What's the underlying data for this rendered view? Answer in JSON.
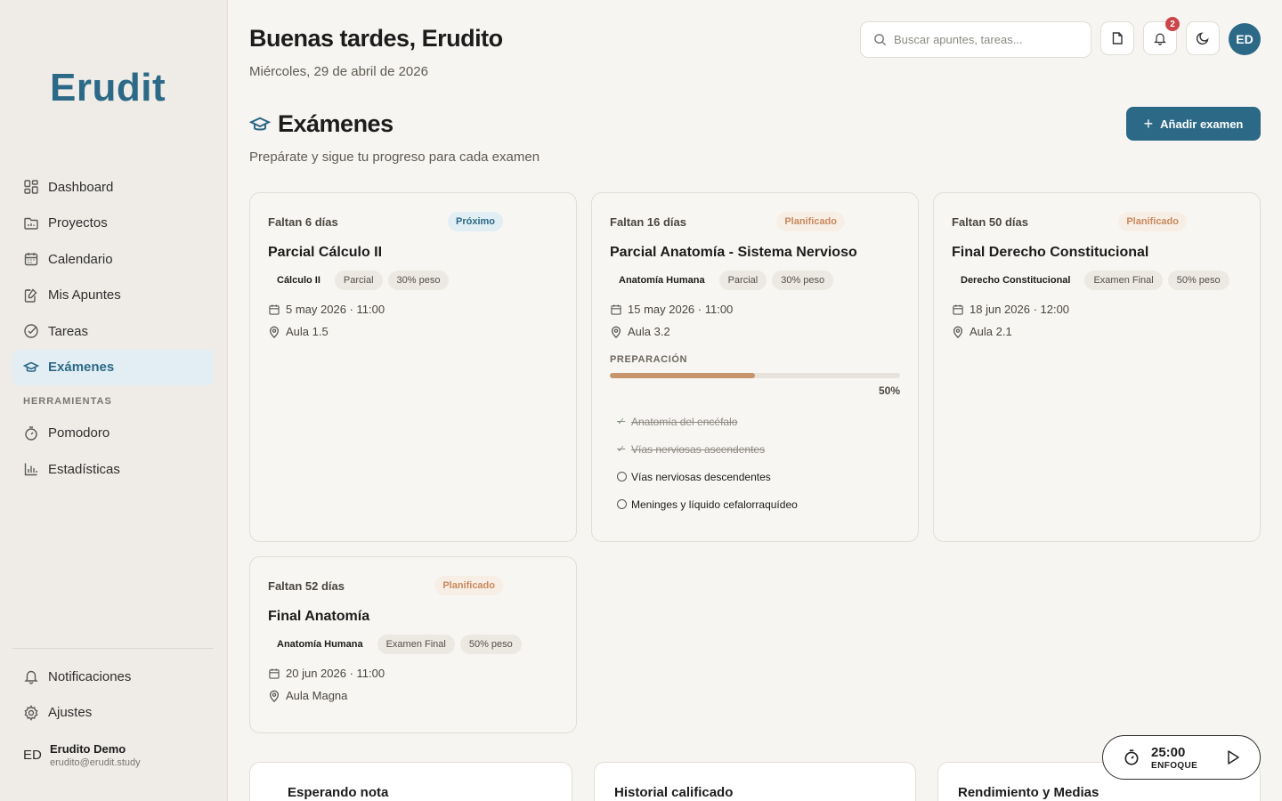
{
  "sidebar": {
    "logo": "Erudit",
    "nav": [
      {
        "label": "Dashboard",
        "icon": "dashboard-icon"
      },
      {
        "label": "Proyectos",
        "icon": "folder-icon"
      },
      {
        "label": "Calendario",
        "icon": "calendar-icon"
      },
      {
        "label": "Mis Apuntes",
        "icon": "notes-icon"
      },
      {
        "label": "Tareas",
        "icon": "check-circle-icon"
      },
      {
        "label": "Exámenes",
        "icon": "graduation-cap-icon",
        "active": true
      }
    ],
    "tools_label": "HERRAMIENTAS",
    "tools": [
      {
        "label": "Pomodoro",
        "icon": "timer-icon"
      },
      {
        "label": "Estadísticas",
        "icon": "bar-chart-icon"
      }
    ],
    "bottom": [
      {
        "label": "Notificaciones",
        "icon": "bell-icon"
      },
      {
        "label": "Ajustes",
        "icon": "gear-icon"
      }
    ],
    "user": {
      "initials": "ED",
      "name": "Erudito Demo",
      "email": "erudito@erudit.study"
    }
  },
  "header": {
    "greeting": "Buenas tardes, Erudito",
    "date": "Miércoles, 29 de abril de 2026",
    "search_placeholder": "Buscar apuntes, tareas...",
    "notifications_count": "2",
    "avatar_initials": "ED"
  },
  "page": {
    "title": "Exámenes",
    "subtitle": "Prepárate y sigue tu progreso para cada examen",
    "add_button": "Añadir examen"
  },
  "exams": [
    {
      "countdown": "Faltan 6 días",
      "status": "Próximo",
      "status_type": "proximo",
      "title": "Parcial Cálculo II",
      "subject": "Cálculo II",
      "kind": "Parcial",
      "weight": "30% peso",
      "datetime": "5 may 2026 · 11:00",
      "location": "Aula 1.5"
    },
    {
      "countdown": "Faltan 16 días",
      "status": "Planificado",
      "status_type": "plan",
      "title": "Parcial Anatomía - Sistema Nervioso",
      "subject": "Anatomía Humana",
      "kind": "Parcial",
      "weight": "30% peso",
      "datetime": "15 may 2026 · 11:00",
      "location": "Aula 3.2",
      "prep_label": "PREPARACIÓN",
      "prep_percent": 50,
      "prep_percent_label": "50%",
      "topics": [
        {
          "label": "Anatomía del encéfalo",
          "done": true
        },
        {
          "label": "Vías nerviosas ascendentes",
          "done": true
        },
        {
          "label": "Vías nerviosas descendentes",
          "done": false
        },
        {
          "label": "Meninges y líquido cefalorraquídeo",
          "done": false
        }
      ]
    },
    {
      "countdown": "Faltan 50 días",
      "status": "Planificado",
      "status_type": "plan",
      "title": "Final Derecho Constitucional",
      "subject": "Derecho Constitucional",
      "kind": "Examen Final",
      "weight": "50% peso",
      "datetime": "18 jun 2026 · 12:00",
      "location": "Aula 2.1"
    },
    {
      "countdown": "Faltan 52 días",
      "status": "Planificado",
      "status_type": "plan",
      "title": "Final Anatomía",
      "subject": "Anatomía Humana",
      "kind": "Examen Final",
      "weight": "50% peso",
      "datetime": "20 jun 2026 · 11:00",
      "location": "Aula Magna"
    }
  ],
  "bottom_cards": [
    "Esperando nota",
    "Historial calificado",
    "Rendimiento y Medias"
  ],
  "pomodoro": {
    "time": "25:00",
    "label": "ENFOQUE"
  },
  "colors": {
    "accent": "#2c6987",
    "planned": "#c9875b",
    "progress": "#c8946b"
  }
}
